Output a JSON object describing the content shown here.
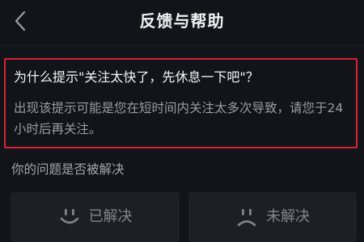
{
  "nav": {
    "title": "反馈与帮助",
    "back_icon": "chevron-left-icon"
  },
  "faq": {
    "question": "为什么提示\"关注太快了，先休息一下吧\"？",
    "answer": "出现该提示可能是您在短时间内关注太多次导致，请您于24小时后再关注。"
  },
  "feedback": {
    "prompt": "你的问题是否被解决",
    "resolved_label": "已解决",
    "resolved_icon": "smile-icon",
    "unresolved_label": "未解决",
    "unresolved_icon": "frown-icon"
  },
  "colors": {
    "background": "#131419",
    "highlight_border": "#d6213a",
    "button_background": "#1e1f25"
  }
}
